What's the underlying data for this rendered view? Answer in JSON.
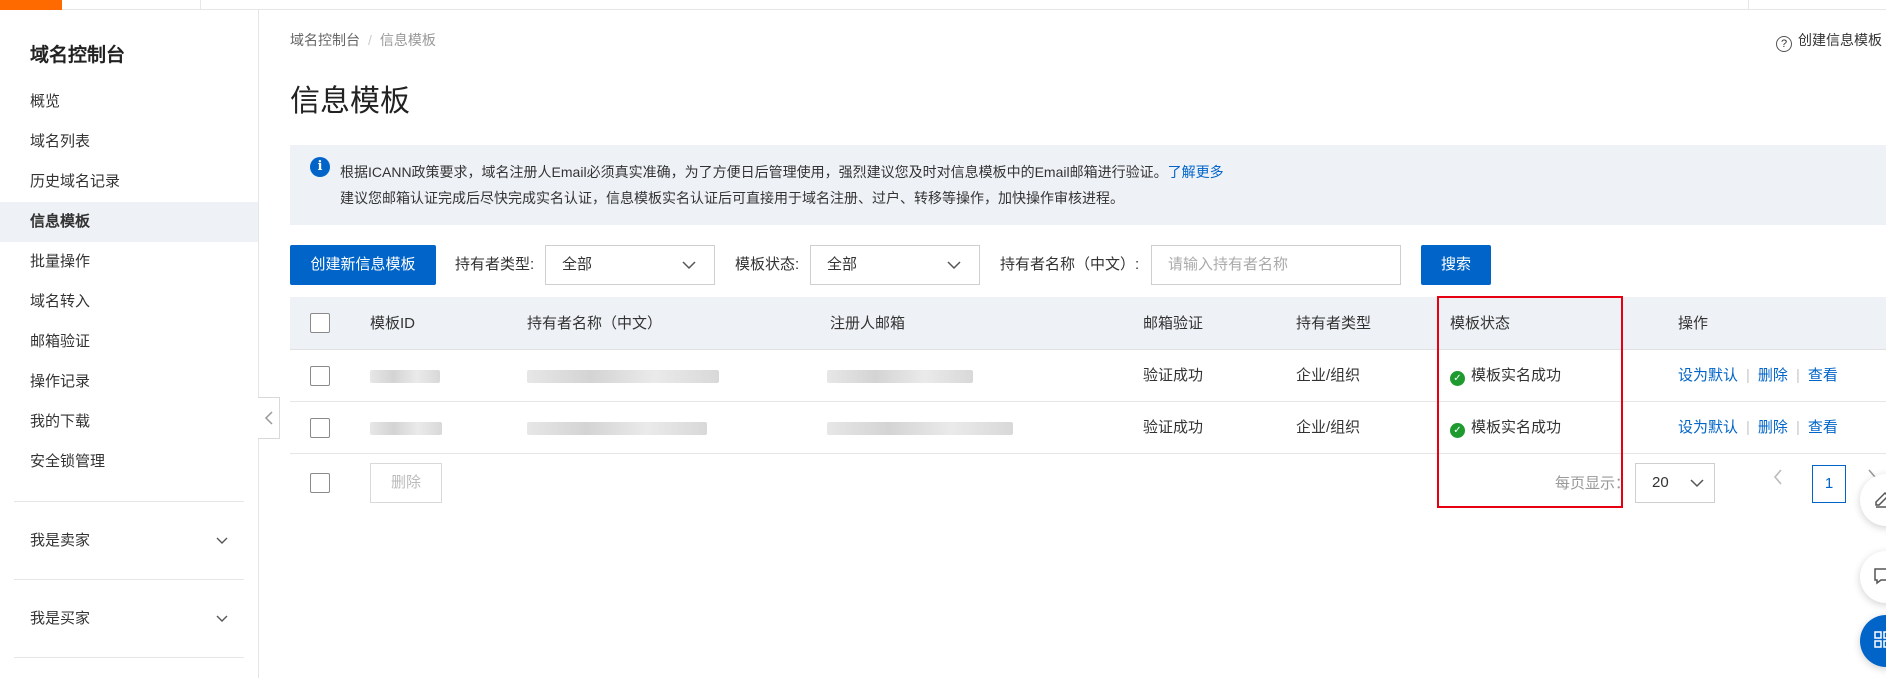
{
  "sidebar": {
    "title": "域名控制台",
    "items": [
      {
        "label": "概览"
      },
      {
        "label": "域名列表"
      },
      {
        "label": "历史域名记录"
      },
      {
        "label": "信息模板",
        "active": true
      },
      {
        "label": "批量操作"
      },
      {
        "label": "域名转入"
      },
      {
        "label": "邮箱验证"
      },
      {
        "label": "操作记录"
      },
      {
        "label": "我的下载"
      },
      {
        "label": "安全锁管理"
      }
    ],
    "groups": [
      {
        "label": "我是卖家"
      },
      {
        "label": "我是买家"
      }
    ]
  },
  "breadcrumb": {
    "root": "域名控制台",
    "separator": "/",
    "current": "信息模板"
  },
  "page": {
    "title": "信息模板",
    "help_link": "创建信息模板"
  },
  "notice": {
    "line1": "根据ICANN政策要求，域名注册人Email必须真实准确，为了方便日后管理使用，强烈建议您及时对信息模板中的Email邮箱进行验证。",
    "learn_more": "了解更多",
    "line2": "建议您邮箱认证完成后尽快完成实名认证，信息模板实名认证后可直接用于域名注册、过户、转移等操作，加快操作审核进程。"
  },
  "toolbar": {
    "create_label": "创建新信息模板",
    "holder_type_label": "持有者类型:",
    "holder_type_value": "全部",
    "template_status_label": "模板状态:",
    "template_status_value": "全部",
    "holder_name_label": "持有者名称（中文）:",
    "holder_name_placeholder": "请输入持有者名称",
    "search_label": "搜索"
  },
  "table": {
    "columns": [
      "模板ID",
      "持有者名称（中文）",
      "注册人邮箱",
      "邮箱验证",
      "持有者类型",
      "模板状态",
      "操作"
    ],
    "rows": [
      {
        "email_verify": "验证成功",
        "holder_type": "企业/组织",
        "status": "模板实名成功"
      },
      {
        "email_verify": "验证成功",
        "holder_type": "企业/组织",
        "status": "模板实名成功"
      }
    ],
    "actions": {
      "set_default": "设为默认",
      "delete": "删除",
      "view": "查看"
    }
  },
  "footer": {
    "delete_label": "删除",
    "page_size_label": "每页显示：",
    "page_size_value": "20",
    "current_page": "1"
  },
  "colors": {
    "primary": "#0064c8",
    "brand": "#ff6a00",
    "success": "#1e9a2f",
    "highlight": "#e60012"
  }
}
